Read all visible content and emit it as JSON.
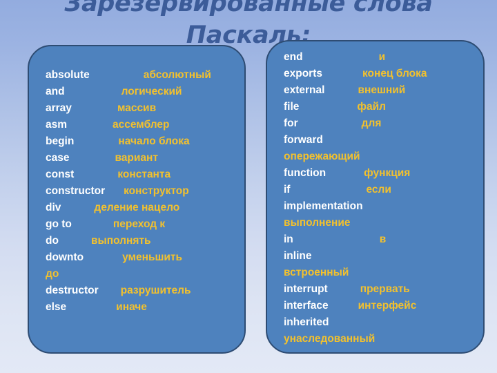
{
  "slide": {
    "title": "Зарезервированные слова Паскаль:",
    "background_top_color": "#93acdf",
    "background_bottom_color": "#e3e9f6",
    "panel_fill_color": "#4e82be",
    "panel_border_color": "#2e4c73",
    "term_color": "#ffffff",
    "translation_color": "#f2c12e"
  },
  "left_panel": {
    "rows": [
      {
        "term": "absolute",
        "translation": "абсолютный",
        "indent": 78
      },
      {
        "term": "and",
        "translation": "логический",
        "indent": 82
      },
      {
        "term": "array",
        "translation": "массив",
        "indent": 66
      },
      {
        "term": "asm",
        "translation": "ассемблер",
        "indent": 66
      },
      {
        "term": "begin",
        "translation": "начало блока",
        "indent": 64
      },
      {
        "term": "case",
        "translation": "вариант",
        "indent": 66
      },
      {
        "term": "const",
        "translation": "константа",
        "indent": 63
      },
      {
        "term": "constructor",
        "translation": "конструктор",
        "indent": 27
      },
      {
        "term": "div",
        "translation": "деление нацело",
        "indent": 48
      },
      {
        "term": "go to",
        "translation": "переход к",
        "indent": 60
      },
      {
        "term": "do",
        "translation": "выполнять",
        "indent": 47
      },
      {
        "term": "downto",
        "translation": "уменьшить",
        "indent": 56
      },
      {
        "term": "",
        "translation": "до",
        "indent": 0
      },
      {
        "term": "destructor",
        "translation": "разрушитель",
        "indent": 32
      },
      {
        "term": "else",
        "translation": "иначе",
        "indent": 72
      }
    ]
  },
  "right_panel": {
    "rows": [
      {
        "term": "end",
        "translation": "и",
        "indent": 110
      },
      {
        "term": "exports",
        "translation": "конец блока",
        "indent": 58
      },
      {
        "term": "external",
        "translation": "внешний",
        "indent": 48
      },
      {
        "term": "file",
        "translation": "файл",
        "indent": 84
      },
      {
        "term": "for",
        "translation": "для",
        "indent": 92
      },
      {
        "term": "forward",
        "translation": "",
        "indent": 0
      },
      {
        "term": "",
        "translation": "опережающий",
        "indent": 0
      },
      {
        "term": "function",
        "translation": "функция",
        "indent": 55
      },
      {
        "term": "if",
        "translation": "если",
        "indent": 110
      },
      {
        "term": "implementation",
        "translation": "",
        "indent": 0
      },
      {
        "term": "",
        "translation": "выполнение",
        "indent": 0
      },
      {
        "term": "in",
        "translation": "в",
        "indent": 125
      },
      {
        "term": "inline",
        "translation": "",
        "indent": 0
      },
      {
        "term": "",
        "translation": "встроенный",
        "indent": 0
      },
      {
        "term": "interrupt",
        "translation": "прервать",
        "indent": 47
      },
      {
        "term": "interface",
        "translation": "интерфейс",
        "indent": 43
      },
      {
        "term": "inherited",
        "translation": "",
        "indent": 0
      },
      {
        "term": "",
        "translation": "унаследованный",
        "indent": 0
      }
    ]
  }
}
